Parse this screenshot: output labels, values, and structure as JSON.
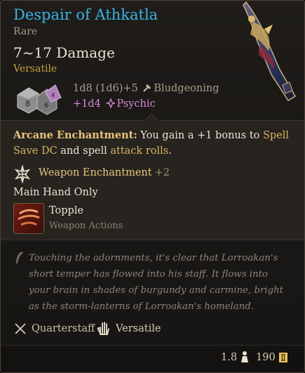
{
  "item": {
    "name": "Despair of Athkatla",
    "rarity": "Rare",
    "damage": "7~17 Damage",
    "tag": "Versatile",
    "damage_line1": "1d8 (1d6)+5",
    "damage_type1": "Bludgeoning",
    "damage_line2": "+1d4",
    "damage_type2": "Psychic"
  },
  "arcane": {
    "label": "Arcane Enchantment:",
    "text_a": " You gain a +1 bonus to ",
    "hl_a": "Spell Save DC",
    "text_b": " and spell ",
    "hl_b": "attack rolls",
    "text_c": "."
  },
  "weapon_enchantment": {
    "label": "Weapon Enchantment",
    "bonus": "+2"
  },
  "main_hand": "Main Hand Only",
  "action": {
    "name": "Topple",
    "category": "Weapon Actions"
  },
  "lore": "Touching the adornments, it's clear that Lorroakan's short temper has flowed into his staff. It flows into your brain in shades of burgundy and carmine, bright as the storm-lanterns of Lorroakan's homeland.",
  "properties": [
    {
      "label": "Quarterstaff",
      "icon": "crossed-staves-icon"
    },
    {
      "label": "Versatile",
      "icon": "open-hand-icon"
    }
  ],
  "footer": {
    "weight": "1.8",
    "price": "190"
  },
  "colors": {
    "title": "#3bb3e4",
    "gold": "#e8c67a",
    "psychic": "#d58ad2"
  }
}
